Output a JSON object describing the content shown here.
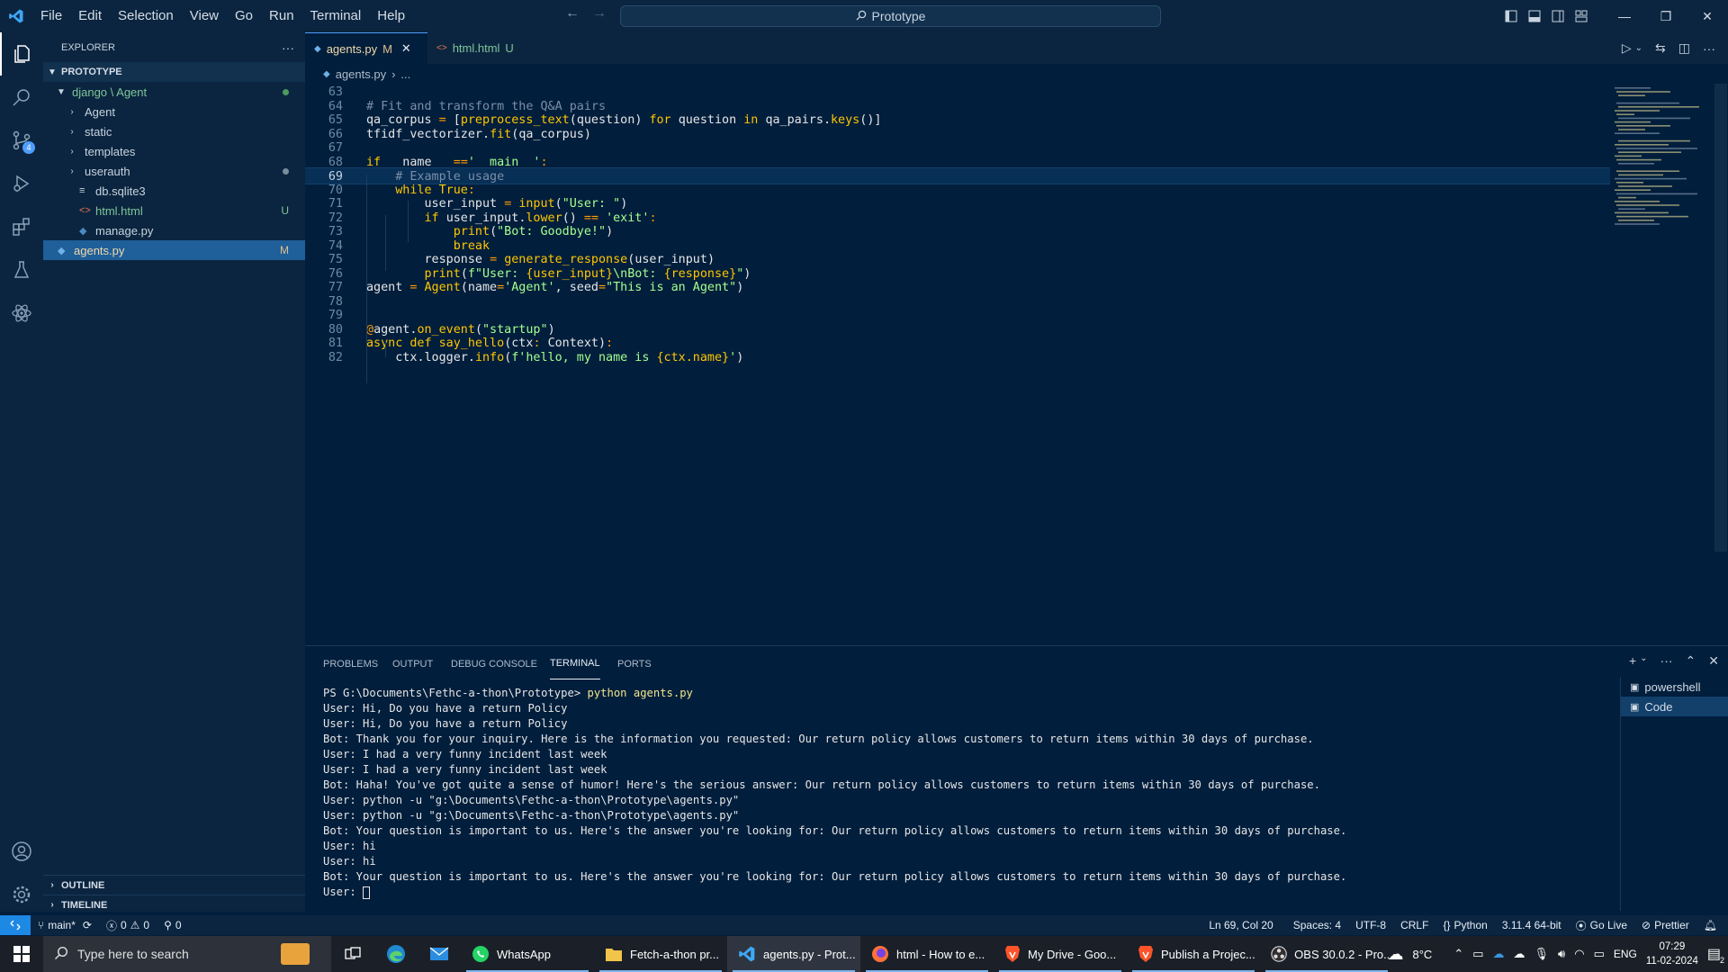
{
  "titlebar": {
    "menu": [
      "File",
      "Edit",
      "Selection",
      "View",
      "Go",
      "Run",
      "Terminal",
      "Help"
    ],
    "search": "Prototype"
  },
  "sidebar": {
    "title": "EXPLORER",
    "more": "···",
    "project": "PROTOTYPE",
    "folder": "django \\ Agent",
    "items": [
      {
        "label": "Agent",
        "type": "folder"
      },
      {
        "label": "static",
        "type": "folder"
      },
      {
        "label": "templates",
        "type": "folder"
      },
      {
        "label": "userauth",
        "type": "folder"
      },
      {
        "label": "db.sqlite3",
        "type": "file"
      },
      {
        "label": "html.html",
        "type": "file",
        "status": "U"
      },
      {
        "label": "manage.py",
        "type": "file"
      },
      {
        "label": "agents.py",
        "type": "file",
        "status": "M"
      }
    ],
    "outline": "OUTLINE",
    "timeline": "TIMELINE"
  },
  "tabs": [
    {
      "label": "agents.py",
      "status": "M"
    },
    {
      "label": "html.html",
      "status": "U"
    }
  ],
  "breadcrumb": {
    "file": "agents.py",
    "rest": "..."
  },
  "editor": {
    "current_line": 69,
    "lines": [
      {
        "n": 63,
        "text": ""
      },
      {
        "n": 64,
        "text": "# Fit and transform the Q&A pairs"
      },
      {
        "n": 65,
        "text": "qa_corpus = [preprocess_text(question) for question in qa_pairs.keys()]"
      },
      {
        "n": 66,
        "text": "tfidf_vectorizer.fit(qa_corpus)"
      },
      {
        "n": 67,
        "text": ""
      },
      {
        "n": 68,
        "text": "if __name__ =='__main__':"
      },
      {
        "n": 69,
        "text": "    # Example usage"
      },
      {
        "n": 70,
        "text": "    while True:"
      },
      {
        "n": 71,
        "text": "        user_input = input(\"User: \")"
      },
      {
        "n": 72,
        "text": "        if user_input.lower() == 'exit':"
      },
      {
        "n": 73,
        "text": "            print(\"Bot: Goodbye!\")"
      },
      {
        "n": 74,
        "text": "            break"
      },
      {
        "n": 75,
        "text": "        response = generate_response(user_input)"
      },
      {
        "n": 76,
        "text": "        print(f\"User: {user_input}\\nBot: {response}\")"
      },
      {
        "n": 77,
        "text": "agent = Agent(name='Agent', seed=\"This is an Agent\")"
      },
      {
        "n": 78,
        "text": ""
      },
      {
        "n": 79,
        "text": ""
      },
      {
        "n": 80,
        "text": "@agent.on_event(\"startup\")"
      },
      {
        "n": 81,
        "text": "async def say_hello(ctx: Context):"
      },
      {
        "n": 82,
        "text": "    ctx.logger.info(f'hello, my name is {ctx.name}')"
      }
    ]
  },
  "panel": {
    "tabs": [
      "PROBLEMS",
      "OUTPUT",
      "DEBUG CONSOLE",
      "TERMINAL",
      "PORTS"
    ],
    "active_tab": "TERMINAL",
    "terminal_lines": [
      "PS G:\\Documents\\Fethc-a-thon\\Prototype> python agents.py",
      "User: Hi, Do you have a return Policy",
      "User: Hi, Do you have a return Policy",
      "Bot: Thank you for your inquiry. Here is the information you requested: Our return policy allows customers to return items within 30 days of purchase.",
      "User: I had a very funny incident last week",
      "User: I had a very funny incident last week",
      "Bot: Haha! You've got quite a sense of humor! Here's the serious answer: Our return policy allows customers to return items within 30 days of purchase.",
      "User: python -u \"g:\\Documents\\Fethc-a-thon\\Prototype\\agents.py\"",
      "User: python -u \"g:\\Documents\\Fethc-a-thon\\Prototype\\agents.py\"",
      "Bot: Your question is important to us. Here's the answer you're looking for: Our return policy allows customers to return items within 30 days of purchase.",
      "User: hi",
      "User: hi",
      "Bot: Your question is important to us. Here's the answer you're looking for: Our return policy allows customers to return items within 30 days of purchase.",
      "User: "
    ],
    "terminals": [
      "powershell",
      "Code"
    ]
  },
  "statusbar": {
    "branch": "main*",
    "errors": "0",
    "warnings": "0",
    "ports": "0",
    "position": "Ln 69, Col 20",
    "spaces": "Spaces: 4",
    "encoding": "UTF-8",
    "eol": "CRLF",
    "language": "Python",
    "interpreter": "3.11.4 64-bit",
    "golive": "Go Live",
    "prettier": "Prettier"
  },
  "taskbar": {
    "search_placeholder": "Type here to search",
    "apps": [
      {
        "label": "WhatsApp",
        "icon": "whatsapp-icon"
      },
      {
        "label": "Fetch-a-thon pr...",
        "icon": "folder-icon"
      },
      {
        "label": "agents.py - Prot...",
        "icon": "vscode-icon",
        "active": true
      },
      {
        "label": "html - How to e...",
        "icon": "firefox-icon"
      },
      {
        "label": "My Drive - Goo...",
        "icon": "brave-icon"
      },
      {
        "label": "Publish a Projec...",
        "icon": "brave-icon"
      },
      {
        "label": "OBS 30.0.2 - Pro...",
        "icon": "obs-icon"
      }
    ],
    "weather": "8°C",
    "lang": "ENG",
    "time": "07:29",
    "date": "11-02-2024",
    "notifications": "2"
  },
  "colors": {
    "accent": "#4d9dfc",
    "editor_bg": "#011e3c",
    "chrome_bg": "#0b2540",
    "keyword": "#ffc600",
    "string": "#a5ff90",
    "comment": "#7a8ea8"
  }
}
